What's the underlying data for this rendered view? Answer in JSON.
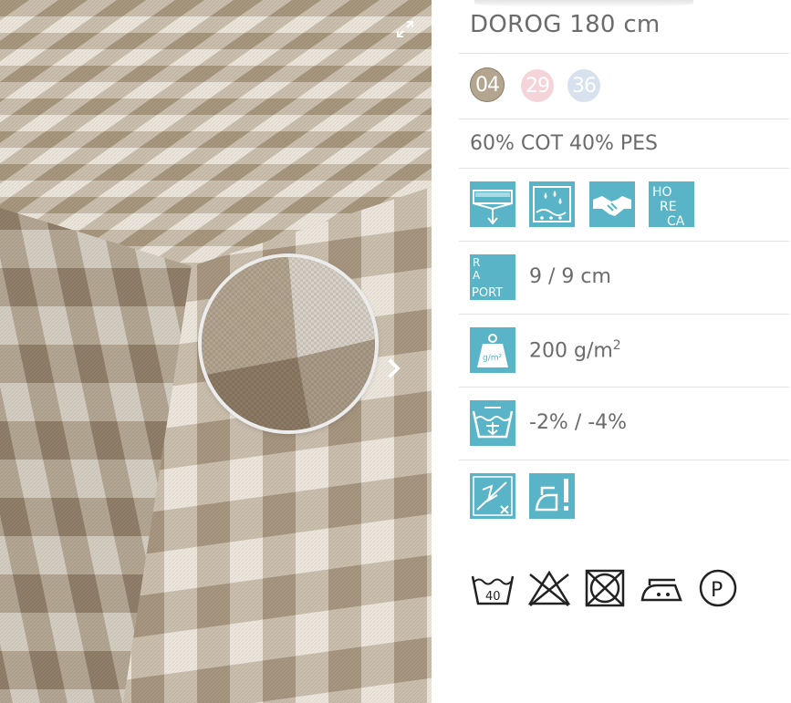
{
  "product": {
    "title": "DOROG 180 cm",
    "composition": "60% COT 40% PES",
    "colors": [
      {
        "code": "04",
        "hex": "#b3a58f",
        "selected": true
      },
      {
        "code": "29",
        "hex": "#f4d4d8",
        "selected": false
      },
      {
        "code": "36",
        "hex": "#d8e1ee",
        "selected": false
      }
    ]
  },
  "feature_icons": [
    "tablecloth-icon",
    "water-repellent-icon",
    "handshake-icon",
    "horeca-icon"
  ],
  "horeca_letters": [
    "HO",
    "RE",
    "CA"
  ],
  "raport": {
    "icon_letters": [
      "R",
      "A",
      "PORT"
    ],
    "value": "9 / 9 cm"
  },
  "weight": {
    "icon_label": "g/m²",
    "value_main": "200 g/m",
    "value_sup": "2"
  },
  "shrinkage": {
    "value": "-2% / -4%"
  },
  "extra_icons": [
    "no-bleach-cross-icon",
    "iron-warning-icon"
  ],
  "care_symbols": [
    {
      "name": "wash-40-icon",
      "label": "40"
    },
    {
      "name": "do-not-bleach-icon"
    },
    {
      "name": "do-not-tumble-dry-icon"
    },
    {
      "name": "iron-two-dots-icon"
    },
    {
      "name": "dry-clean-p-icon",
      "label": "P"
    }
  ],
  "colors": {
    "accent": "#58b4c6",
    "text": "#6b6b6b",
    "divider": "#e3e3e3",
    "fabric_beige": "#a8977f",
    "fabric_white": "#ece6dc"
  }
}
